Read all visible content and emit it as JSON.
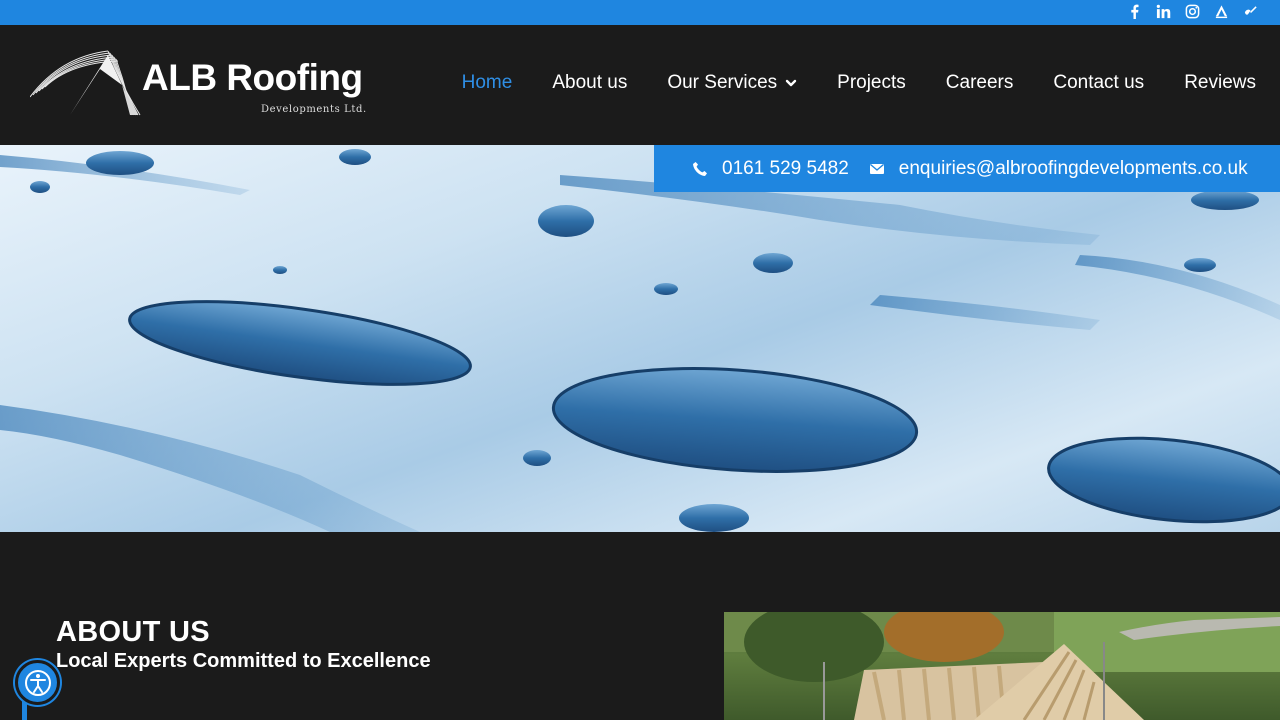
{
  "topbar": {
    "social_icons": [
      "facebook-icon",
      "linkedin-icon",
      "instagram-icon",
      "checkatrade-icon",
      "trustatrader-icon"
    ]
  },
  "brand": {
    "name": "ALB Roofing",
    "subtitle": "Developments Ltd."
  },
  "nav": {
    "items": [
      {
        "label": "Home",
        "active": true
      },
      {
        "label": "About us"
      },
      {
        "label": "Our Services",
        "has_dropdown": true
      },
      {
        "label": "Projects"
      },
      {
        "label": "Careers"
      },
      {
        "label": "Contact us"
      },
      {
        "label": "Reviews"
      }
    ]
  },
  "contact": {
    "phone": "0161 529 5482",
    "email": "enquiries@albroofingdevelopments.co.uk"
  },
  "about": {
    "heading": "ABOUT US",
    "subheading": "Local Experts Committed to Excellence"
  },
  "colors": {
    "accent": "#1f86e0",
    "nav_active": "#2f8fe6",
    "background": "#1b1b1b"
  },
  "accessibility": {
    "icon": "accessibility-icon"
  }
}
